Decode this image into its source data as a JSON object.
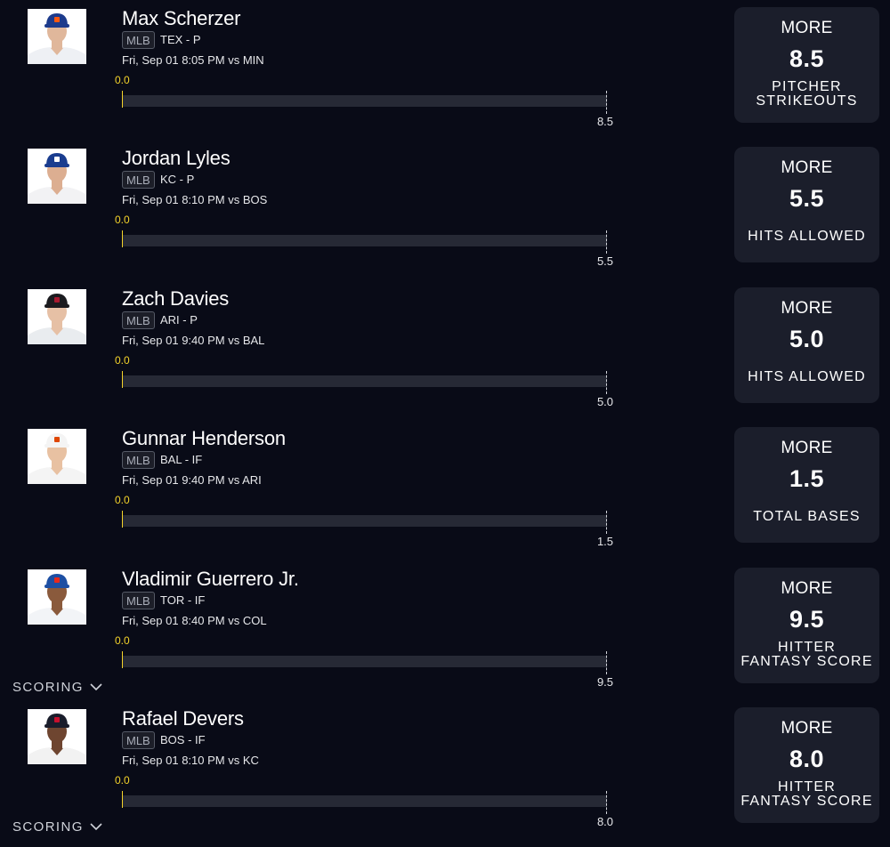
{
  "colors": {
    "background": "#090b17",
    "card": "#1b1e2b",
    "track": "#262935",
    "current_value": "#f5d42a"
  },
  "scoring_label": "SCORING",
  "projections": [
    {
      "player": "Max Scherzer",
      "league": "MLB",
      "team_position": "TEX - P",
      "game": "Fri, Sep 01 8:05 PM  vs MIN",
      "current": "0.0",
      "goal": "8.5",
      "direction": "MORE",
      "line": "8.5",
      "stat": [
        "PITCHER",
        "STRIKEOUTS"
      ],
      "scoring_dropdown": false,
      "avatar_icon": "player-headshot-mets-cap-icon",
      "cap_color": "#1d3b8c",
      "logo_color": "#ff5910",
      "jersey_color": "#eef0f4",
      "skin": "#e0b79b"
    },
    {
      "player": "Jordan Lyles",
      "league": "MLB",
      "team_position": "KC - P",
      "game": "Fri, Sep 01 8:10 PM  vs BOS",
      "current": "0.0",
      "goal": "5.5",
      "direction": "MORE",
      "line": "5.5",
      "stat": [
        "HITS ALLOWED"
      ],
      "scoring_dropdown": false,
      "avatar_icon": "player-headshot-rangers-cap-icon",
      "cap_color": "#1a3d8f",
      "logo_color": "#ffffff",
      "jersey_color": "#f2f2f4",
      "skin": "#dcae91"
    },
    {
      "player": "Zach Davies",
      "league": "MLB",
      "team_position": "ARI - P",
      "game": "Fri, Sep 01 9:40 PM  vs BAL",
      "current": "0.0",
      "goal": "5.0",
      "direction": "MORE",
      "line": "5.0",
      "stat": [
        "HITS ALLOWED"
      ],
      "scoring_dropdown": false,
      "avatar_icon": "player-headshot-diamondbacks-cap-icon",
      "cap_color": "#1b1b1f",
      "logo_color": "#a71930",
      "jersey_color": "#e9ecef",
      "skin": "#e6c0a5"
    },
    {
      "player": "Gunnar Henderson",
      "league": "MLB",
      "team_position": "BAL - IF",
      "game": "Fri, Sep 01 9:40 PM  vs ARI",
      "current": "0.0",
      "goal": "1.5",
      "direction": "MORE",
      "line": "1.5",
      "stat": [
        "TOTAL BASES"
      ],
      "scoring_dropdown": false,
      "avatar_icon": "player-headshot-orioles-cap-icon",
      "cap_color": "#f4f4f4",
      "logo_color": "#df4601",
      "jersey_color": "#f4f4f4",
      "skin": "#e8c1a2"
    },
    {
      "player": "Vladimir Guerrero Jr.",
      "league": "MLB",
      "team_position": "TOR - IF",
      "game": "Fri, Sep 01 8:40 PM  vs COL",
      "current": "0.0",
      "goal": "9.5",
      "direction": "MORE",
      "line": "9.5",
      "stat": [
        "HITTER",
        "FANTASY SCORE"
      ],
      "scoring_dropdown": true,
      "avatar_icon": "player-headshot-blue-jays-cap-icon",
      "cap_color": "#1d4fa3",
      "logo_color": "#e8291c",
      "jersey_color": "#f2f4f7",
      "skin": "#8a5a3c"
    },
    {
      "player": "Rafael Devers",
      "league": "MLB",
      "team_position": "BOS - IF",
      "game": "Fri, Sep 01 8:10 PM  vs KC",
      "current": "0.0",
      "goal": "8.0",
      "direction": "MORE",
      "line": "8.0",
      "stat": [
        "HITTER",
        "FANTASY SCORE"
      ],
      "scoring_dropdown": true,
      "avatar_icon": "player-headshot-red-sox-cap-icon",
      "cap_color": "#1a1d2b",
      "logo_color": "#c8102e",
      "jersey_color": "#f2f2f2",
      "skin": "#6e4530"
    }
  ]
}
